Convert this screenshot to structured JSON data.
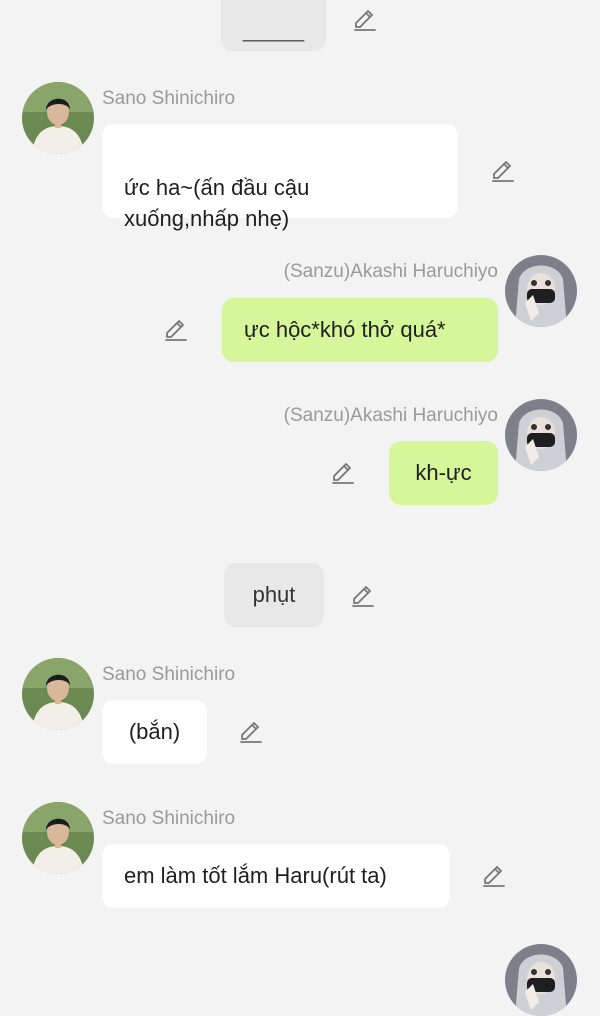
{
  "messages": [
    {
      "id": "m0",
      "type": "narration",
      "text": "_____"
    },
    {
      "id": "m1",
      "sender": "Sano Shinichiro",
      "side": "left",
      "text": "ức ha~(ấn đầu cậu\nxuống,nhấp nhẹ)"
    },
    {
      "id": "m2",
      "sender": "(Sanzu)Akashi Haruchiyo",
      "side": "right",
      "text": "ực hộc*khó thở quá*"
    },
    {
      "id": "m3",
      "sender": "(Sanzu)Akashi Haruchiyo",
      "side": "right",
      "text": "kh-ực"
    },
    {
      "id": "m4",
      "type": "narration",
      "text": "phụt"
    },
    {
      "id": "m5",
      "sender": "Sano Shinichiro",
      "side": "left",
      "text": "(bắn)"
    },
    {
      "id": "m6",
      "sender": "Sano Shinichiro",
      "side": "left",
      "text": "em làm tốt lắm Haru(rút ta)"
    }
  ],
  "icons": {
    "edit": "pencil-icon"
  },
  "colors": {
    "background": "#f3f3f3",
    "left_bubble": "#ffffff",
    "right_bubble": "#d6f69a",
    "narration_bubble": "#e8e8e8",
    "sender_name": "#9a9a9a"
  }
}
